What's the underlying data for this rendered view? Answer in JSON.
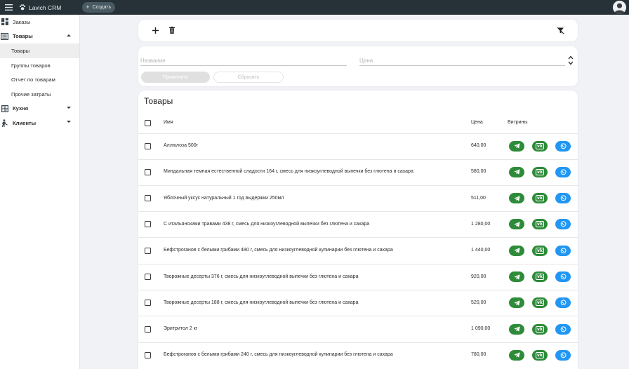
{
  "app": {
    "title": "Lavich CRM",
    "create_label": "Создать"
  },
  "sidebar": {
    "items": [
      {
        "label": "Заказы",
        "icon": "dashboard-icon",
        "level": 0
      },
      {
        "label": "Товары",
        "icon": "list-icon",
        "level": 0,
        "expanded": true
      },
      {
        "label": "Товары",
        "level": 1,
        "active": true
      },
      {
        "label": "Группы товаров",
        "level": 1
      },
      {
        "label": "Отчет по товарам",
        "level": 1
      },
      {
        "label": "Прочие затраты",
        "level": 1
      },
      {
        "label": "Кухня",
        "icon": "calculator-icon",
        "level": 0,
        "expanded": false
      },
      {
        "label": "Клиенты",
        "icon": "person-icon",
        "level": 0,
        "expanded": false
      }
    ]
  },
  "filter": {
    "name_placeholder": "Название",
    "price_placeholder": "Цена",
    "apply_label": "Применить",
    "reset_label": "Сбросить"
  },
  "table": {
    "title": "Товары",
    "columns": {
      "name": "Имя",
      "price": "Цена",
      "shops": "Витрины"
    },
    "rows": [
      {
        "name": "Аллюлоза 500г",
        "price": "640,00"
      },
      {
        "name": "Миндальная темная естественной сладости 164 г, смесь для низкоуглеводной выпечки без глютена и сахара",
        "price": "580,00"
      },
      {
        "name": "Яблочный уксус натуральный 1 год выдержки 250мл",
        "price": "511,00"
      },
      {
        "name": "С итальянскими травами 438 г, смесь для низкоуглеводной выпечки без глютена и сахара",
        "price": "1 280,00"
      },
      {
        "name": "Бефстроганов с белыми грибами 480 г, смесь для низкоуглеводной кулинарии без глютена и сахара",
        "price": "1 440,00"
      },
      {
        "name": "Творожные десерты 376 г, смесь для низкоуглеводной выпечки без глютена и сахара",
        "price": "920,00"
      },
      {
        "name": "Творожные десерты 188 г, смесь для низкоуглеводной выпечки без глютена и сахара",
        "price": "520,00"
      },
      {
        "name": "Эритритол 2 кг",
        "price": "1 090,00"
      },
      {
        "name": "Бефстроганов с белыми грибами 240 г, смесь для низкоуглеводной кулинарии без глютена и сахара",
        "price": "780,00"
      }
    ]
  },
  "colors": {
    "topbar": "#263238",
    "telegram": "#2e8b3a",
    "vk": "#2e8b3a",
    "whatsapp": "#2196f3"
  }
}
